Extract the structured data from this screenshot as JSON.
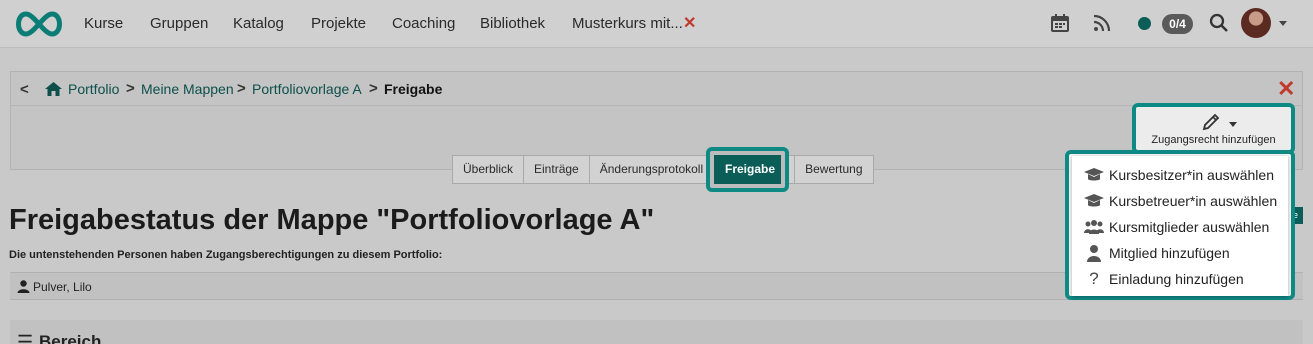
{
  "topnav": {
    "logo": "infinity-logo",
    "links": [
      "Kurse",
      "Gruppen",
      "Katalog",
      "Projekte",
      "Coaching",
      "Bibliothek",
      "Musterkurs mit..."
    ],
    "badge": "0/4"
  },
  "breadcrumb": {
    "items": [
      "Portfolio",
      "Meine Mappen",
      "Portfoliovorlage A"
    ],
    "current": "Freigabe"
  },
  "tabs": [
    "Überblick",
    "Einträge",
    "Änderungsprotokoll",
    "Freigabe",
    "Bewertung"
  ],
  "active_tab": "Freigabe",
  "add_access": {
    "label": "Zugangsrecht hinzufügen"
  },
  "dropdown": {
    "items": [
      {
        "label": "Kursbesitzer*in auswählen",
        "icon": "graduation-cap-icon"
      },
      {
        "label": "Kursbetreuer*in auswählen",
        "icon": "graduation-cap-icon"
      },
      {
        "label": "Kursmitglieder auswählen",
        "icon": "users-icon"
      },
      {
        "label": "Mitglied hinzufügen",
        "icon": "user-icon"
      },
      {
        "label": "Einladung hinzufügen",
        "icon": "question-icon"
      }
    ]
  },
  "main": {
    "title": "Freigabestatus der Mappe \"Portfoliovorlage A\"",
    "subtitle": "Die untenstehenden Personen haben Zugangsberechtigungen zu diesem Portfolio:",
    "users": [
      "Pulver, Lilo"
    ],
    "section_title": "Bereich"
  },
  "colors": {
    "accent": "#0b5d58",
    "highlight": "#0e8a84",
    "close": "#c0392b"
  }
}
